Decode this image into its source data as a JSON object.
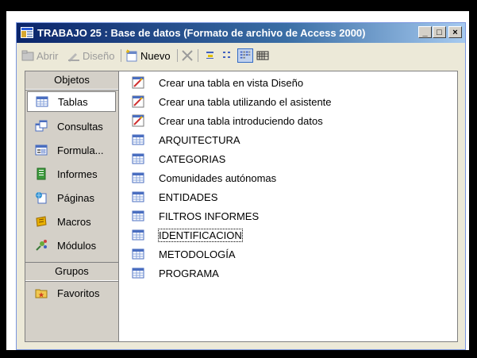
{
  "window": {
    "title": "TRABAJO 25 : Base de datos (Formato de archivo de Access 2000)",
    "controls": {
      "minimize": "_",
      "maximize": "□",
      "close": "×"
    }
  },
  "toolbar": {
    "open_label": "Abrir",
    "design_label": "Diseño",
    "new_label": "Nuevo"
  },
  "sidebar": {
    "objects_header": "Objetos",
    "items": [
      {
        "label": "Tablas",
        "icon": "table-icon",
        "selected": true
      },
      {
        "label": "Consultas",
        "icon": "query-icon"
      },
      {
        "label": "Formula...",
        "icon": "form-icon"
      },
      {
        "label": "Informes",
        "icon": "report-icon"
      },
      {
        "label": "Páginas",
        "icon": "page-icon"
      },
      {
        "label": "Macros",
        "icon": "macro-icon"
      },
      {
        "label": "Módulos",
        "icon": "module-icon"
      }
    ],
    "groups_header": "Grupos",
    "groups": [
      {
        "label": "Favoritos",
        "icon": "favorites-icon"
      }
    ]
  },
  "list": {
    "items": [
      {
        "label": "Crear una tabla en vista Diseño",
        "icon": "wizard-icon"
      },
      {
        "label": "Crear una tabla utilizando el asistente",
        "icon": "wizard-icon"
      },
      {
        "label": "Crear una tabla introduciendo datos",
        "icon": "wizard-icon"
      },
      {
        "label": "ARQUITECTURA",
        "icon": "table-icon"
      },
      {
        "label": "CATEGORIAS",
        "icon": "table-icon"
      },
      {
        "label": "Comunidades autónomas",
        "icon": "table-icon"
      },
      {
        "label": "ENTIDADES",
        "icon": "table-icon"
      },
      {
        "label": "FILTROS INFORMES",
        "icon": "table-icon"
      },
      {
        "label": "IDENTIFICACION",
        "icon": "table-icon",
        "focused": true
      },
      {
        "label": "METODOLOGÍA",
        "icon": "table-icon"
      },
      {
        "label": "PROGRAMA",
        "icon": "table-icon"
      }
    ]
  },
  "colors": {
    "title_gradient_start": "#0a246a",
    "title_gradient_end": "#a6caf0",
    "window_face": "#ece9d8",
    "objbar_face": "#d4d0c8"
  }
}
